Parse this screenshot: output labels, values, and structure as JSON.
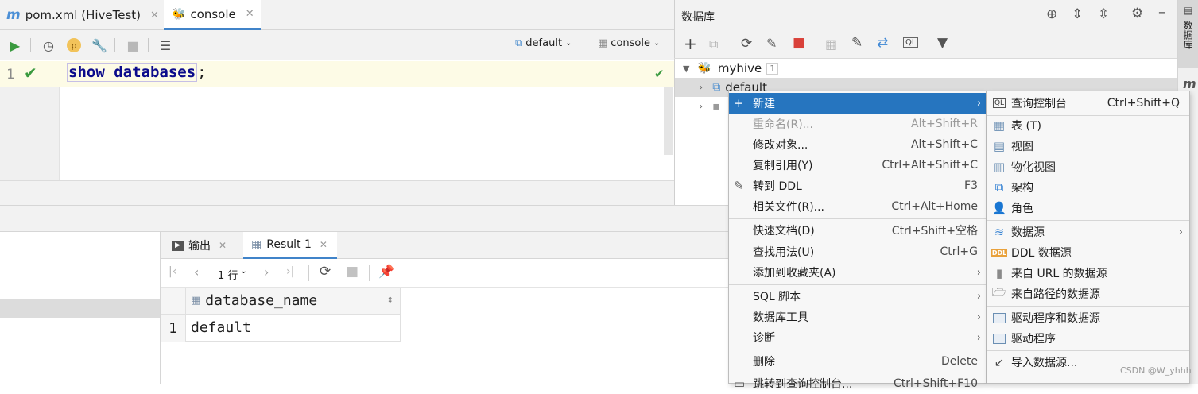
{
  "editor_tabs": [
    {
      "label": "pom.xml (HiveTest)",
      "icon": "maven-m-icon"
    },
    {
      "label": "console",
      "icon": "hive-bee-icon"
    }
  ],
  "toolbar": {
    "datasource_label": "default",
    "console_label": "console"
  },
  "editor": {
    "line_number": "1",
    "code_keyword": "show databases",
    "code_suffix": ";"
  },
  "db_panel": {
    "title": "数据库",
    "tree": [
      {
        "label": "myhive",
        "badge": "1"
      },
      {
        "label": "default"
      }
    ]
  },
  "right_strip": {
    "label": "数据库",
    "letter": "m"
  },
  "result_tabs": [
    {
      "label": "输出",
      "icon": "console-output-icon"
    },
    {
      "label": "Result 1",
      "icon": "table-icon"
    }
  ],
  "result_toolbar": {
    "rows_label": "1 行"
  },
  "grid": {
    "columns": [
      "database_name"
    ],
    "rows": [
      {
        "num": "1",
        "values": [
          "default"
        ]
      }
    ]
  },
  "context_menu": {
    "items": [
      {
        "label": "新建",
        "shortcut": "",
        "submenu": true,
        "selected": true,
        "disabled": false
      },
      {
        "label": "重命名(R)...",
        "shortcut": "Alt+Shift+R",
        "submenu": false,
        "selected": false,
        "disabled": true
      },
      {
        "label": "修改对象...",
        "shortcut": "Alt+Shift+C",
        "submenu": false,
        "selected": false,
        "disabled": false
      },
      {
        "label": "复制引用(Y)",
        "shortcut": "Ctrl+Alt+Shift+C",
        "submenu": false,
        "selected": false,
        "disabled": false
      },
      {
        "label": "转到 DDL",
        "shortcut": "F3",
        "submenu": false,
        "selected": false,
        "disabled": false
      },
      {
        "label": "相关文件(R)...",
        "shortcut": "Ctrl+Alt+Home",
        "submenu": false,
        "selected": false,
        "disabled": false
      },
      {
        "label": "快速文档(D)",
        "shortcut": "Ctrl+Shift+空格",
        "submenu": false,
        "selected": false,
        "disabled": false
      },
      {
        "label": "查找用法(U)",
        "shortcut": "Ctrl+G",
        "submenu": false,
        "selected": false,
        "disabled": false
      },
      {
        "label": "添加到收藏夹(A)",
        "shortcut": "",
        "submenu": true,
        "selected": false,
        "disabled": false
      },
      {
        "label": "SQL 脚本",
        "shortcut": "",
        "submenu": true,
        "selected": false,
        "disabled": false
      },
      {
        "label": "数据库工具",
        "shortcut": "",
        "submenu": true,
        "selected": false,
        "disabled": false
      },
      {
        "label": "诊断",
        "shortcut": "",
        "submenu": true,
        "selected": false,
        "disabled": false
      },
      {
        "label": "删除",
        "shortcut": "Delete",
        "submenu": false,
        "selected": false,
        "disabled": false
      },
      {
        "label": "跳转到查询控制台...",
        "shortcut": "Ctrl+Shift+F10",
        "submenu": false,
        "selected": false,
        "disabled": false
      }
    ]
  },
  "submenu": {
    "items": [
      {
        "label": "查询控制台",
        "shortcut": "Ctrl+Shift+Q",
        "icon": "query-console-icon"
      },
      {
        "label": "表 (T)",
        "shortcut": "",
        "icon": "table-icon"
      },
      {
        "label": "视图",
        "shortcut": "",
        "icon": "view-icon"
      },
      {
        "label": "物化视图",
        "shortcut": "",
        "icon": "materialized-view-icon"
      },
      {
        "label": "架构",
        "shortcut": "",
        "icon": "schema-icon"
      },
      {
        "label": "角色",
        "shortcut": "",
        "icon": "role-icon"
      },
      {
        "label": "数据源",
        "shortcut": "",
        "icon": "datasource-icon",
        "submenu": true
      },
      {
        "label": "DDL 数据源",
        "shortcut": "",
        "icon": "ddl-icon"
      },
      {
        "label": "来自 URL 的数据源",
        "shortcut": "",
        "icon": "url-datasource-icon"
      },
      {
        "label": "来自路径的数据源",
        "shortcut": "",
        "icon": "folder-icon"
      },
      {
        "label": "驱动程序和数据源",
        "shortcut": "",
        "icon": "driver-datasource-icon"
      },
      {
        "label": "驱动程序",
        "shortcut": "",
        "icon": "driver-icon"
      },
      {
        "label": "导入数据源...",
        "shortcut": "",
        "icon": "import-icon"
      }
    ]
  },
  "watermark": "CSDN @W_yhhh",
  "colors": {
    "selection": "#2675bf",
    "tab_underline": "#4083c9",
    "run_green": "#3a9a3f",
    "stop_red": "#d9413a"
  }
}
